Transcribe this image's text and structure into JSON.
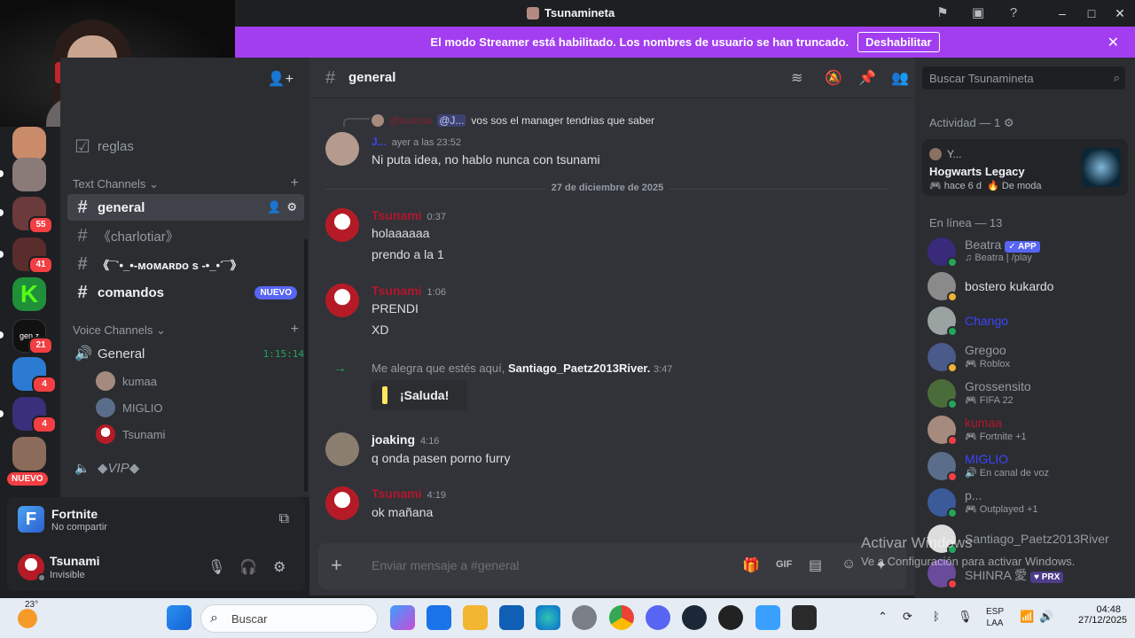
{
  "window": {
    "title": "Tsunamineta"
  },
  "banner": {
    "text": "El modo Streamer está habilitado. Los nombres de usuario se han truncado.",
    "button": "Deshabilitar"
  },
  "servers": {
    "badges": [
      "55",
      "41",
      "21",
      "4",
      "4"
    ],
    "nuevo": "NUEVO"
  },
  "channels": {
    "top_item": "reglas",
    "text_category": "Text Channels",
    "text": [
      {
        "name": "general"
      },
      {
        "name": "《charlotiar》"
      },
      {
        "name": "《¯`•_•-ᴍᴏᴍᴀʀᴅᴏ s -•_•´¯》"
      },
      {
        "name": "comandos",
        "badge": "NUEVO"
      }
    ],
    "voice_category": "Voice Channels",
    "voice": {
      "name": "General",
      "timer": "1:15:14",
      "users": [
        "kumaa",
        "MIGLIO",
        "Tsunami"
      ]
    },
    "vip": "◆VIP◆"
  },
  "activity": {
    "game": "Fortnite",
    "sub": "No compartir"
  },
  "user": {
    "name": "Tsunami",
    "status": "Invisible"
  },
  "chat": {
    "channel": "general",
    "reply": {
      "name": "@kumaa",
      "mention": "@J...",
      "text": "vos sos el manager tendrias que saber"
    },
    "first_msg": {
      "name": "J...",
      "time": "ayer a las 23:52",
      "text": "Ni puta idea, no hablo nunca con tsunami"
    },
    "divider": "27 de diciembre de 2025",
    "messages": [
      {
        "name": "Tsunami",
        "time": "0:37",
        "lines": [
          "holaaaaaa",
          "prendo a la 1"
        ]
      },
      {
        "name": "Tsunami",
        "time": "1:06",
        "lines": [
          "PRENDI",
          "XD"
        ]
      }
    ],
    "system": {
      "prefix": "Me alegra que estés aquí,",
      "name": "Santiago_Paetz2013River.",
      "time": "3:47",
      "button": "¡Saluda!"
    },
    "joaking": {
      "name": "joaking",
      "time": "4:16",
      "text": "q onda pasen porno furry"
    },
    "last": {
      "name": "Tsunami",
      "time": "4:19",
      "text": "ok mañana"
    },
    "composer_placeholder": "Enviar mensaje a #general"
  },
  "members": {
    "search_placeholder": "Buscar Tsunamineta",
    "activity_title": "Actividad — 1",
    "activity_card": {
      "user": "Y...",
      "game": "Hogwarts Legacy",
      "ago": "hace 6 d",
      "trend": "De moda"
    },
    "online_title": "En línea — 13",
    "list": [
      {
        "name": "Beatra",
        "tag": "APP",
        "sub": "Beatra | /play",
        "color": "#949ba4"
      },
      {
        "name": "bostero kukardo",
        "sub": "",
        "color": "#dbdee1"
      },
      {
        "name": "Chango",
        "sub": "",
        "color": "#3b45ff"
      },
      {
        "name": "Gregoo",
        "sub": "Roblox",
        "color": "#949ba4"
      },
      {
        "name": "Grossensito",
        "sub": "FIFA 22",
        "color": "#949ba4"
      },
      {
        "name": "kumaa",
        "sub": "Fortnite +1",
        "color": "#b4162c"
      },
      {
        "name": "MIGLIO",
        "sub": "En canal de voz",
        "color": "#3b45ff"
      },
      {
        "name": "p...",
        "sub": "Outplayed +1",
        "color": "#949ba4"
      },
      {
        "name": "Santiago_Paetz2013River",
        "sub": "",
        "color": "#949ba4"
      },
      {
        "name": "SHINRA 愛",
        "tag": "PRX",
        "sub": "",
        "color": "#949ba4"
      }
    ]
  },
  "watermark": {
    "line1": "Activar Windows",
    "line2": "Ve a Configuración para activar Windows."
  },
  "taskbar": {
    "temp": "23°",
    "search": "Buscar",
    "lang": "ESP",
    "layout": "LAA",
    "time": "04:48",
    "date": "27/12/2025"
  }
}
